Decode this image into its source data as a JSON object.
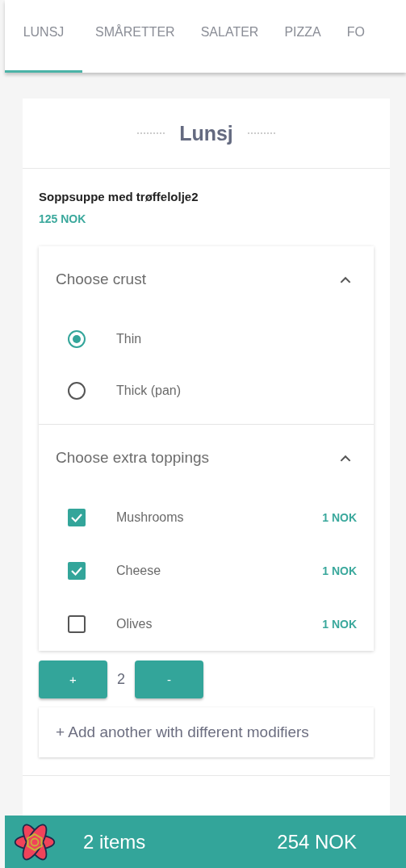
{
  "tabs": [
    {
      "label": "LUNSJ",
      "selected": true
    },
    {
      "label": "SMÅRETTER",
      "selected": false
    },
    {
      "label": "SALATER",
      "selected": false
    },
    {
      "label": "PIZZA",
      "selected": false
    },
    {
      "label": "FO",
      "selected": false
    }
  ],
  "category": {
    "title": "Lunsj"
  },
  "item": {
    "name": "Soppsuppe med trøffelolje2",
    "price": "125 NOK",
    "groups": [
      {
        "title": "Choose crust",
        "expanded": true,
        "kind": "radio",
        "options": [
          {
            "label": "Thin",
            "selected": true
          },
          {
            "label": "Thick (pan)",
            "selected": false
          }
        ]
      },
      {
        "title": "Choose extra toppings",
        "expanded": true,
        "kind": "checkbox",
        "options": [
          {
            "label": "Mushrooms",
            "checked": true,
            "price": "1 NOK"
          },
          {
            "label": "Cheese",
            "checked": true,
            "price": "1 NOK"
          },
          {
            "label": "Olives",
            "checked": false,
            "price": "1 NOK"
          }
        ]
      }
    ],
    "quantity": {
      "increase": "+",
      "count": "2",
      "decrease": "-"
    },
    "add_another": "+ Add another with different modifiers"
  },
  "cart": {
    "count": "2 items",
    "total": "254 NOK"
  }
}
